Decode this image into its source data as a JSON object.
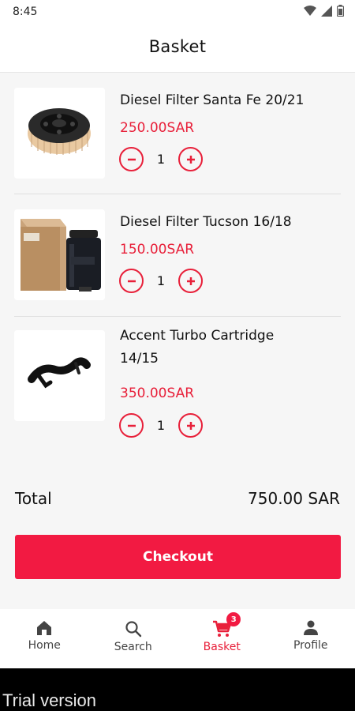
{
  "status_bar": {
    "time": "8:45"
  },
  "header": {
    "title": "Basket"
  },
  "items": [
    {
      "name": "Diesel Filter Santa Fe 20/21",
      "price": "250.00SAR",
      "quantity": "1",
      "image": "round-oil-filter"
    },
    {
      "name": "Diesel Filter Tucson 16/18",
      "price": "150.00SAR",
      "quantity": "1",
      "image": "boxed-fuel-filter"
    },
    {
      "name": "Accent Turbo Cartridge 14/15",
      "price": "350.00SAR",
      "quantity": "1",
      "image": "turbo-hose"
    }
  ],
  "summary": {
    "total_label": "Total",
    "total_value": "750.00 SAR"
  },
  "checkout": {
    "label": "Checkout"
  },
  "nav": {
    "items": [
      {
        "label": "Home",
        "icon": "home-icon"
      },
      {
        "label": "Search",
        "icon": "search-icon"
      },
      {
        "label": "Basket",
        "icon": "cart-icon",
        "badge": "3",
        "active": true
      },
      {
        "label": "Profile",
        "icon": "profile-icon"
      }
    ]
  },
  "watermark": {
    "text": "Trial version"
  },
  "colors": {
    "accent": "#f21a42",
    "price": "#e8203a"
  }
}
